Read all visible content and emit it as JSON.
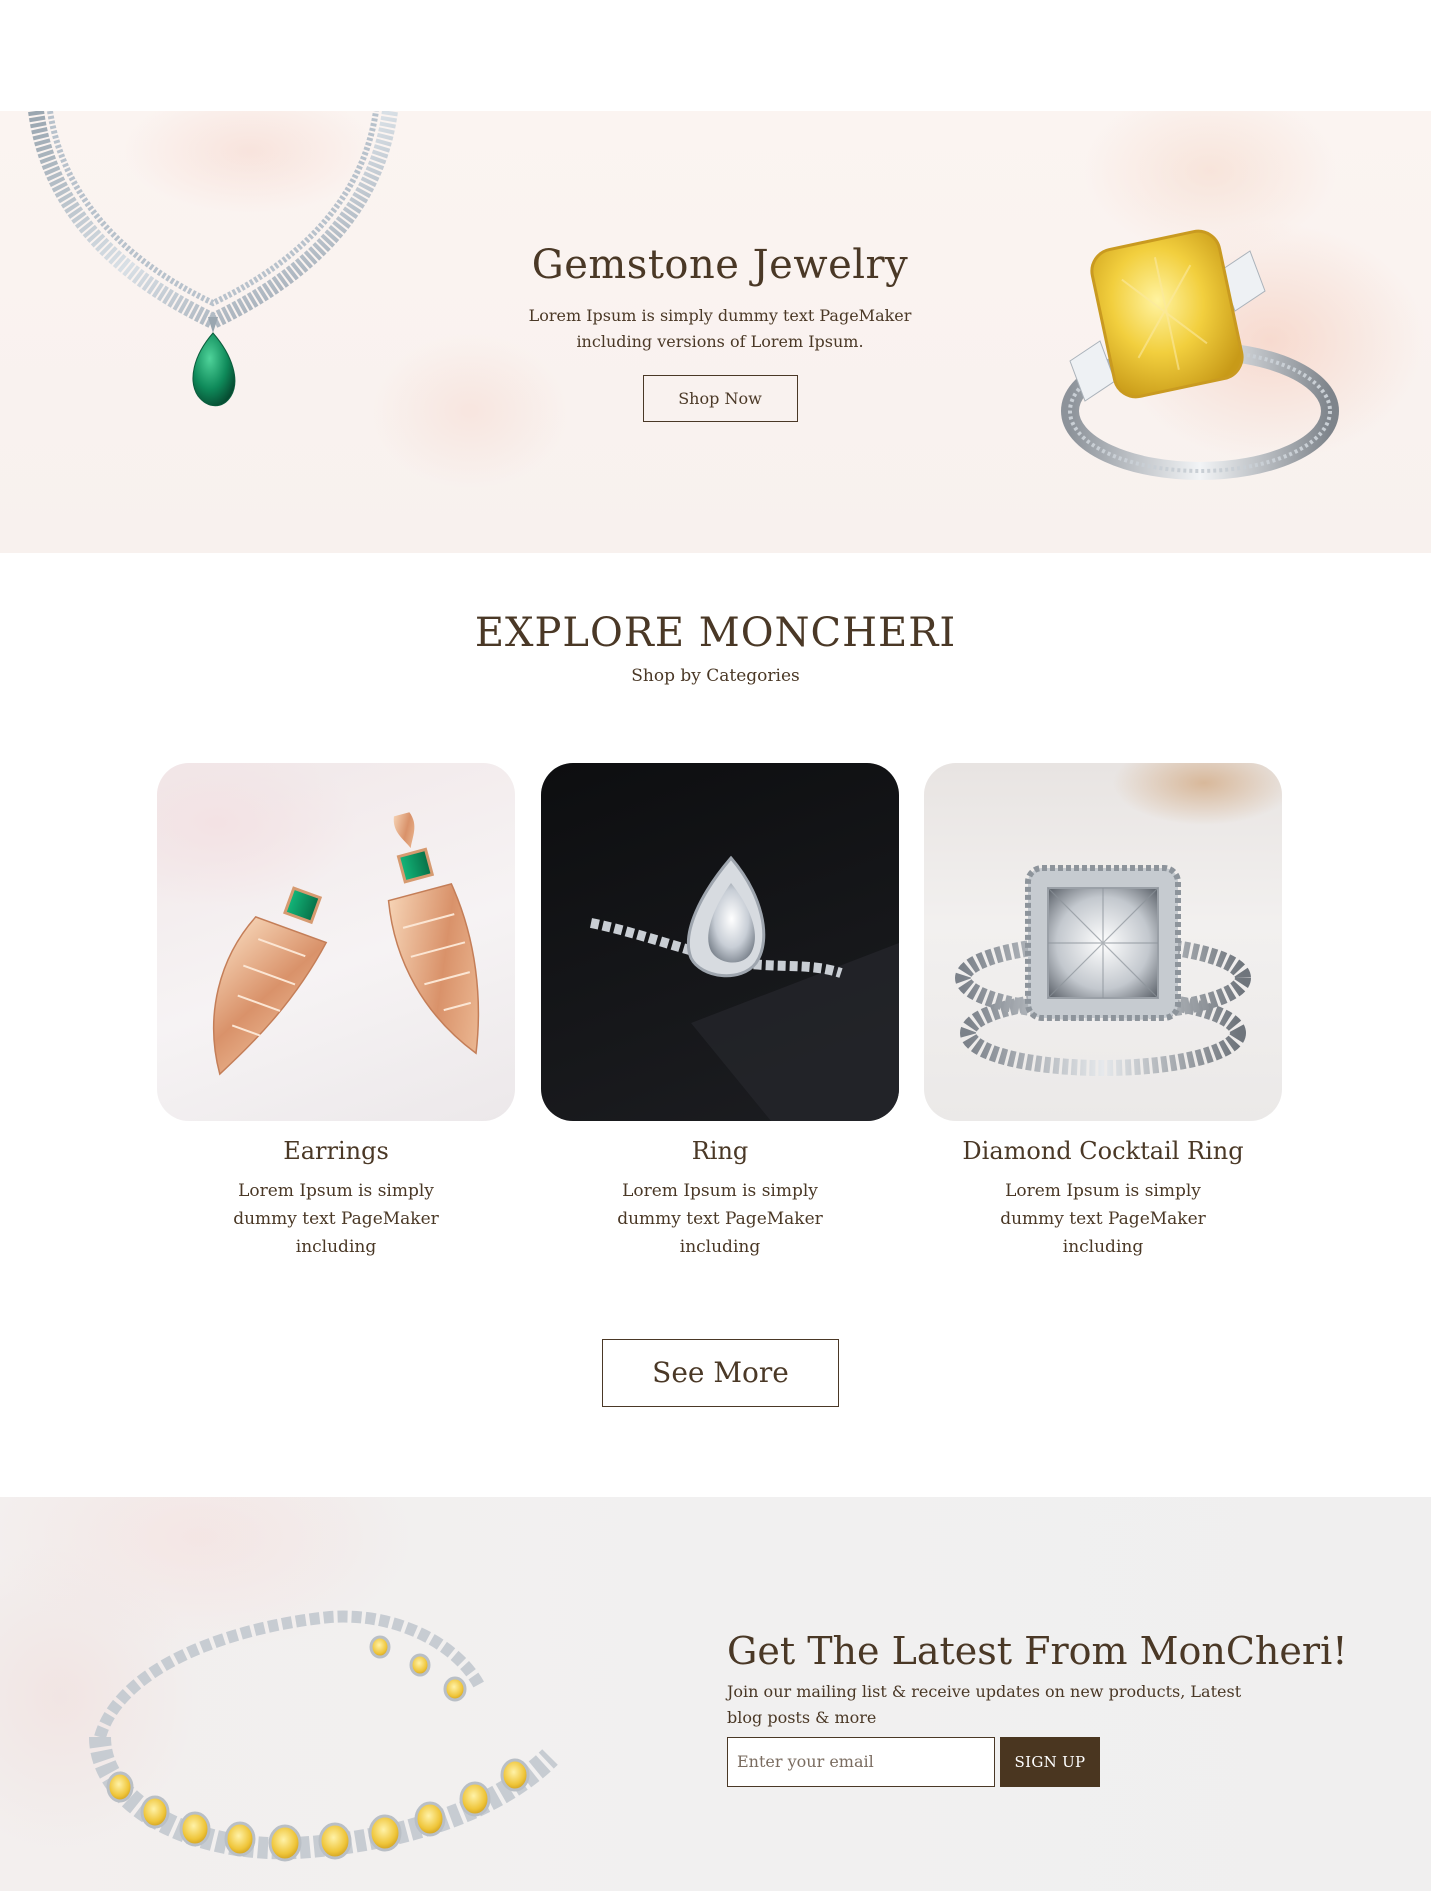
{
  "hero": {
    "title": "Gemstone Jewelry",
    "subtitle": "Lorem Ipsum is simply dummy text PageMaker including versions of Lorem Ipsum.",
    "button_label": "Shop Now"
  },
  "explore": {
    "title": "EXPLORE MONCHERI",
    "subtitle": "Shop by Categories"
  },
  "categories": [
    {
      "title": "Earrings",
      "text": "Lorem Ipsum is simply dummy text PageMaker including"
    },
    {
      "title": "Ring",
      "text": "Lorem Ipsum is simply dummy text PageMaker including"
    },
    {
      "title": "Diamond Cocktail Ring",
      "text": "Lorem Ipsum is simply dummy text PageMaker including"
    }
  ],
  "see_more_label": "See More",
  "newsletter": {
    "title": "Get The Latest From MonCheri!",
    "subtitle": "Join our mailing list & receive updates on new products, Latest blog posts & more",
    "email_placeholder": "Enter your email",
    "signup_label": "SIGN UP"
  },
  "colors": {
    "brand_brown": "#4a3826",
    "signup_bg": "#4a3620"
  }
}
